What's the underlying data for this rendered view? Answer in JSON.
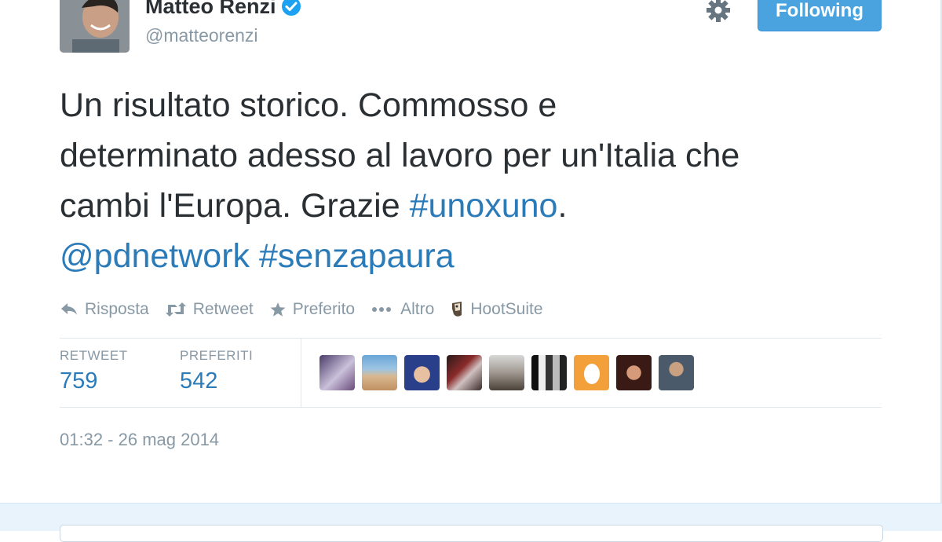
{
  "author": {
    "name": "Matteo Renzi",
    "handle": "@matteorenzi",
    "avatar_icon": "profile-photo",
    "verified_icon": "verified-badge-icon"
  },
  "header": {
    "follow_label": "Following",
    "settings_icon": "gear-icon"
  },
  "tweet": {
    "line1": "Un risultato storico. Commosso e",
    "line2": "determinato adesso al lavoro per un'Italia che",
    "line3_text": "cambi l'Europa. Grazie ",
    "hashtag1": "#unoxuno",
    "line3_end": ".",
    "mention": "@pdnetwork",
    "hashtag2": "#senzapaura"
  },
  "actions": [
    {
      "label": "Risposta",
      "icon": "reply-icon"
    },
    {
      "label": "Retweet",
      "icon": "retweet-icon"
    },
    {
      "label": "Preferito",
      "icon": "star-icon"
    },
    {
      "label": "Altro",
      "icon": "more-icon"
    },
    {
      "label": "HootSuite",
      "icon": "hootsuite-icon"
    }
  ],
  "stats": {
    "retweets_label": "RETWEET",
    "retweets_value": "759",
    "favorites_label": "PREFERITI",
    "favorites_value": "542"
  },
  "timestamp": "01:32 - 26 mag 2014",
  "colors": {
    "link": "#2b7bb9",
    "follow_button": "#4aa3df",
    "muted": "#8899a6",
    "text": "#292f33"
  }
}
